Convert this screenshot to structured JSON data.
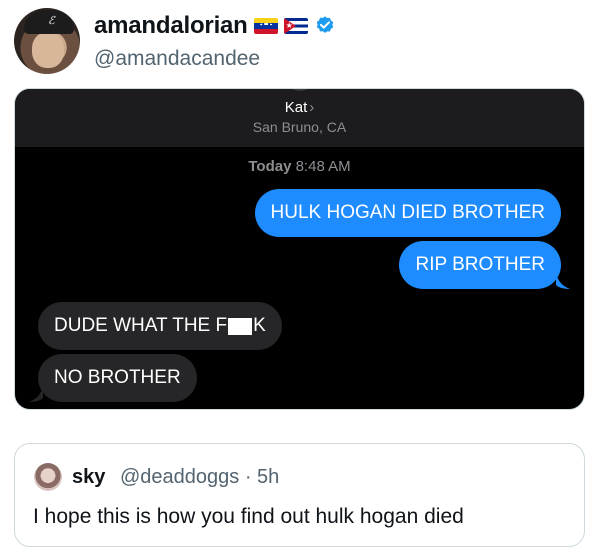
{
  "tweet": {
    "display_name": "amandalorian",
    "handle": "@amandacandee",
    "flags": [
      "venezuela-flag",
      "cuba-flag"
    ],
    "verified": true
  },
  "screenshot": {
    "contact_name": "Kat",
    "contact_chevron": "›",
    "location": "San Bruno, CA",
    "timestamp_day": "Today",
    "timestamp_time": "8:48 AM",
    "messages": [
      {
        "from": "me",
        "text": "HULK HOGAN DIED BROTHER"
      },
      {
        "from": "me",
        "text": "RIP BROTHER"
      },
      {
        "from": "them",
        "text_before": "DUDE WHAT THE F",
        "text_after": "K",
        "censored": true
      },
      {
        "from": "them",
        "text": "NO BROTHER"
      }
    ],
    "colors": {
      "sent_bubble": "#1e8cff",
      "received_bubble": "#262628",
      "background": "#000000"
    }
  },
  "quote": {
    "name": "sky",
    "handle_time": "@deaddoggs · 5h",
    "text": "I hope this is how you find out hulk hogan died"
  },
  "colors": {
    "accent": "#1d9bf0",
    "secondary_text": "#536471"
  }
}
